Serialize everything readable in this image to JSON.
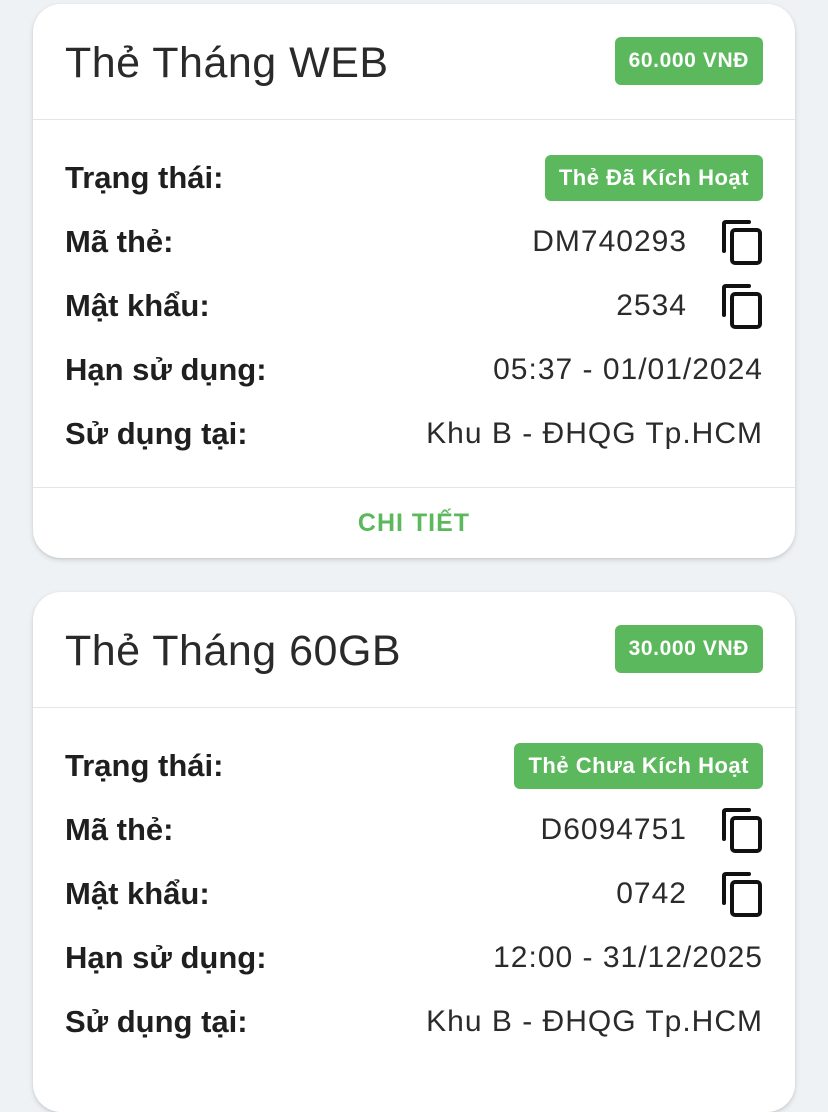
{
  "colors": {
    "accent": "#5cb85c",
    "background": "#eef2f5",
    "card": "#ffffff"
  },
  "labels": {
    "status": "Trạng thái:",
    "code": "Mã thẻ:",
    "password": "Mật khẩu:",
    "expiry": "Hạn sử dụng:",
    "location": "Sử dụng tại:",
    "detail": "CHI TIẾT"
  },
  "cards": [
    {
      "title": "Thẻ Tháng WEB",
      "price": "60.000 VNĐ",
      "status": "Thẻ Đã Kích Hoạt",
      "code": "DM740293",
      "password": "2534",
      "expiry": "05:37 - 01/01/2024",
      "location": "Khu B - ĐHQG Tp.HCM"
    },
    {
      "title": "Thẻ Tháng 60GB",
      "price": "30.000 VNĐ",
      "status": "Thẻ Chưa Kích Hoạt",
      "code": "D6094751",
      "password": "0742",
      "expiry": "12:00 - 31/12/2025",
      "location": "Khu B - ĐHQG Tp.HCM"
    }
  ],
  "icons": {
    "copy": "copy-icon"
  }
}
